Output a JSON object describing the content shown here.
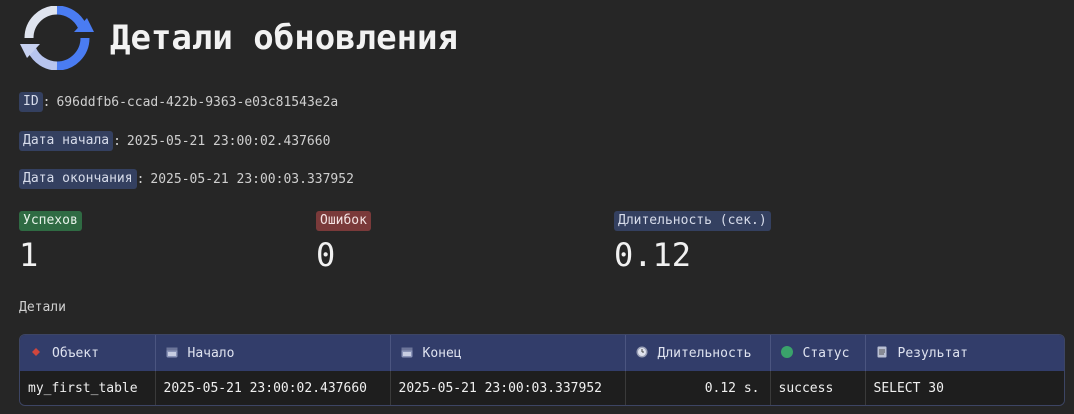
{
  "header": {
    "title": "Детали обновления",
    "icon": "refresh-icon"
  },
  "meta": [
    {
      "label": "ID",
      "value": "696ddfb6-ccad-422b-9363-e03c81543e2a"
    },
    {
      "label": "Дата начала",
      "value": "2025-05-21 23:00:02.437660"
    },
    {
      "label": "Дата окончания",
      "value": "2025-05-21 23:00:03.337952"
    }
  ],
  "stats": [
    {
      "label": "Успехов",
      "value": "1",
      "color": "#2f6b43"
    },
    {
      "label": "Ошибок",
      "value": "0",
      "color": "#7a3a3a"
    },
    {
      "label": "Длительность (сек.)",
      "value": "0.12",
      "color": "#344060"
    }
  ],
  "details_label": "Детали",
  "table": {
    "columns": [
      {
        "label": "Объект",
        "icon": "diamond-icon"
      },
      {
        "label": "Начало",
        "icon": "calendar-icon"
      },
      {
        "label": "Конец",
        "icon": "calendar-icon"
      },
      {
        "label": "Длительность",
        "icon": "clock-icon"
      },
      {
        "label": "Статус",
        "icon": "green-circle-icon"
      },
      {
        "label": "Результат",
        "icon": "document-icon"
      }
    ],
    "rows": [
      [
        "my_first_table",
        "2025-05-21 23:00:02.437660",
        "2025-05-21 23:00:03.337952",
        "0.12 s.",
        "success",
        "SELECT 30"
      ]
    ]
  },
  "colors": {
    "background": "#262626",
    "header_row": "#323d6a",
    "success": "#2f6b43",
    "error": "#7a3a3a",
    "accent": "#344060"
  }
}
